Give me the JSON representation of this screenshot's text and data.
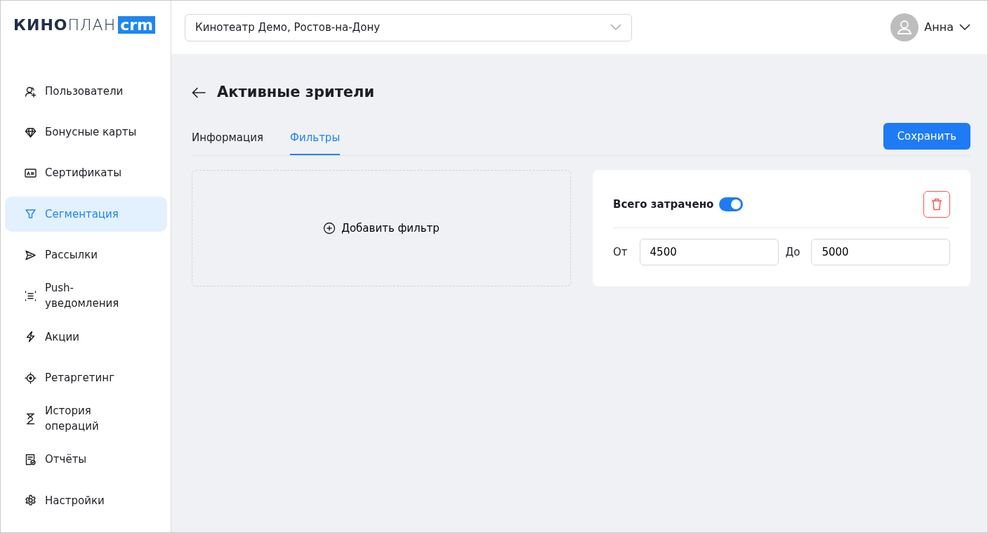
{
  "logo": {
    "bold": "КИНО",
    "light": "ПЛАН",
    "badge": "crm"
  },
  "sidebar": {
    "items": [
      {
        "label": "Пользователи",
        "selected": false
      },
      {
        "label": "Бонусные карты",
        "selected": false
      },
      {
        "label": "Сертификаты",
        "selected": false
      },
      {
        "label": "Сегментация",
        "selected": true
      },
      {
        "label": "Рассылки",
        "selected": false
      },
      {
        "label": "Push-уведомления",
        "selected": false
      },
      {
        "label": "Акции",
        "selected": false
      },
      {
        "label": "Ретаргетинг",
        "selected": false
      },
      {
        "label": "История операций",
        "selected": false
      },
      {
        "label": "Отчёты",
        "selected": false
      },
      {
        "label": "Настройки",
        "selected": false
      }
    ]
  },
  "header": {
    "cinema_select": {
      "value": "Кинотеатр Демо, Ростов-на-Дону"
    },
    "user": {
      "name": "Анна"
    }
  },
  "page": {
    "title": "Активные зрители",
    "tabs": [
      {
        "label": "Информация",
        "selected": false
      },
      {
        "label": "Фильтры",
        "selected": true
      }
    ],
    "save_button": "Сохранить",
    "add_filter": "Добавить фильтр",
    "filter": {
      "title": "Всего затрачено",
      "on": true,
      "from_label": "От",
      "from_value": "4500",
      "to_label": "До",
      "to_value": "5000"
    }
  }
}
